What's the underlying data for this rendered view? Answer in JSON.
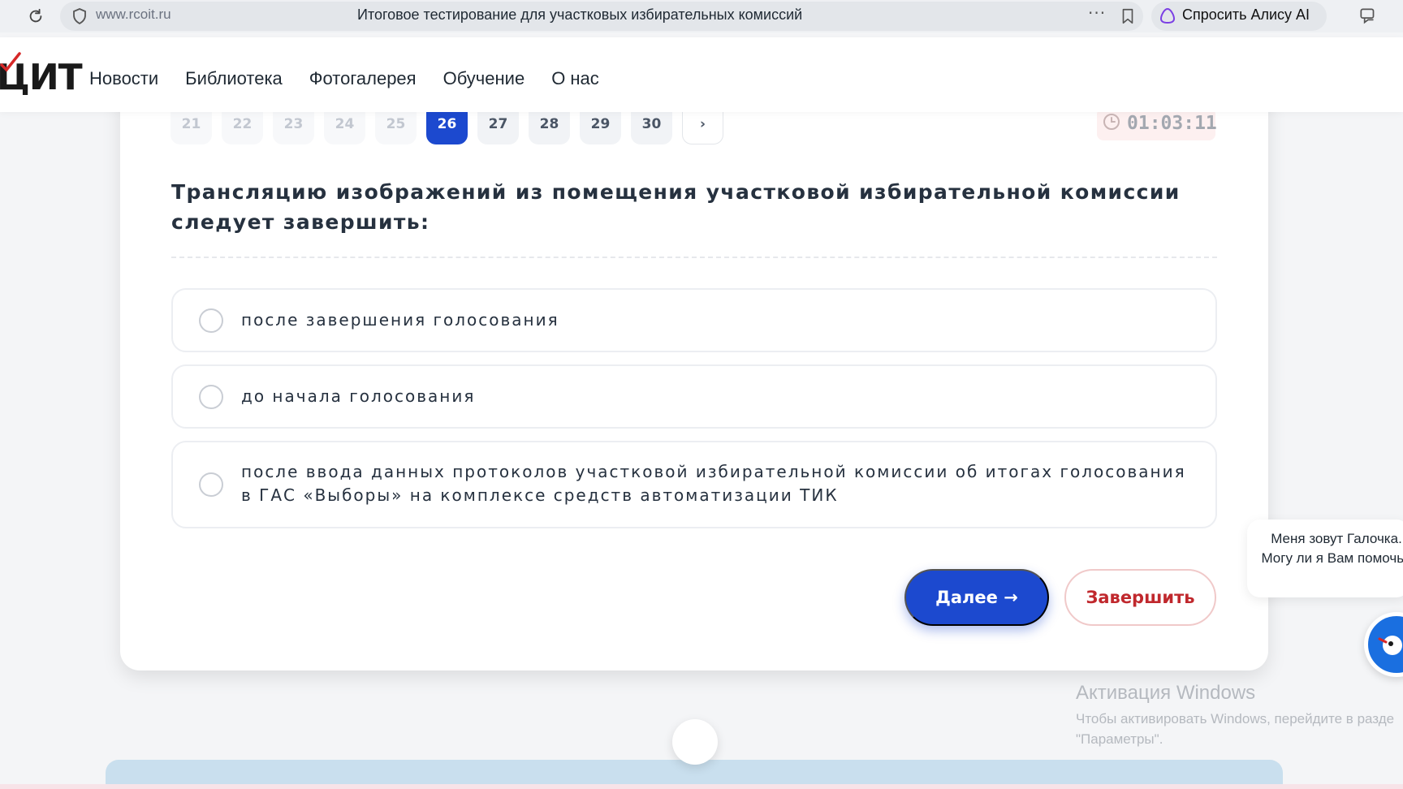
{
  "browser": {
    "url": "www.rcoit.ru",
    "tab_title": "Итоговое тестирование для участковых избирательных комиссий",
    "more": "···",
    "alice_label": "Спросить Алису AI"
  },
  "header": {
    "logo_text": "ЦИТ",
    "nav": [
      "Новости",
      "Библиотека",
      "Фотогалерея",
      "Обучение",
      "О нас"
    ]
  },
  "test": {
    "pages": [
      "21",
      "22",
      "23",
      "24",
      "25",
      "26",
      "27",
      "28",
      "29",
      "30",
      "›"
    ],
    "active_page": "26",
    "timer": "01:03:11",
    "question": "Трансляцию изображений из помещения участковой избирательной комиссии следует завершить:",
    "options": [
      "после завершения голосования",
      "до начала голосования",
      "после ввода данных протоколов участковой избирательной комиссии об итогах голосования в ГАС «Выборы» на комплексе средств автоматизации ТИК"
    ],
    "next_label": "Далее →",
    "finish_label": "Завершить"
  },
  "chat": {
    "message": "Меня зовут Галочка. Могу ли я Вам помочь?"
  },
  "watermark": {
    "title": "Активация Windows",
    "line1": "Чтобы активировать Windows, перейдите в разде",
    "line2": "\"Параметры\"."
  },
  "colors": {
    "accent": "#1c49cf",
    "danger": "#c0282d",
    "timer_bg": "#fdf0f0"
  }
}
